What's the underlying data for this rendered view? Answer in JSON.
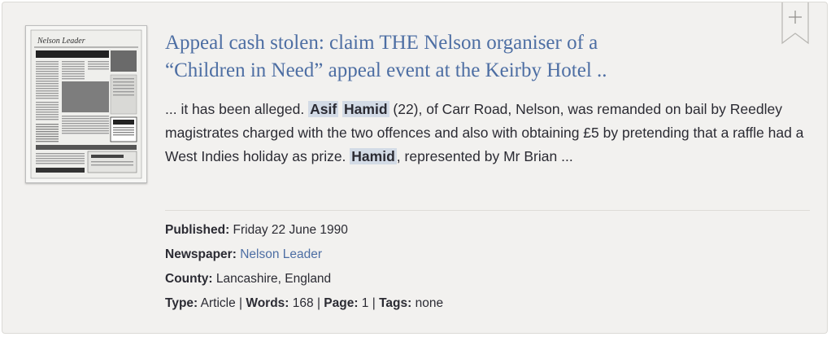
{
  "result": {
    "title_line1": "Appeal cash stolen: claim THE Nelson organiser of a",
    "title_line2": "“Children in Need” appeal event at the Keirby Hotel ..",
    "snippet": {
      "pre": "... it has been alleged. ",
      "hl1": "Asif",
      "hl2": "Hamid",
      "mid": " (22), of Carr Road, Nelson, was remanded on bail by Reedley magistrates charged with the two offences and also with obtaining £5 by pretending that a raffle had a West Indies holiday as prize. ",
      "hl3": "Hamid",
      "post": ", represented by Mr Brian ..."
    },
    "meta": {
      "published_label": "Published:",
      "published_value": " Friday 22 June 1990",
      "newspaper_label": "Newspaper:",
      "newspaper_value": "Nelson Leader",
      "county_label": "County:",
      "county_value": " Lancashire, England",
      "type_label": "Type:",
      "type_value": " Article | ",
      "words_label": "Words:",
      "words_value": " 168 | ",
      "page_label": "Page:",
      "page_value": " 1 | ",
      "tags_label": "Tags:",
      "tags_value": " none"
    },
    "thumbnail": {
      "masthead": "Nelson Leader"
    },
    "bookmark_icon": "plus"
  },
  "colors": {
    "card_bg": "#f2f1ef",
    "link": "#4d6ea3",
    "highlight": "#d3dbe6",
    "text": "#2b2b33"
  }
}
